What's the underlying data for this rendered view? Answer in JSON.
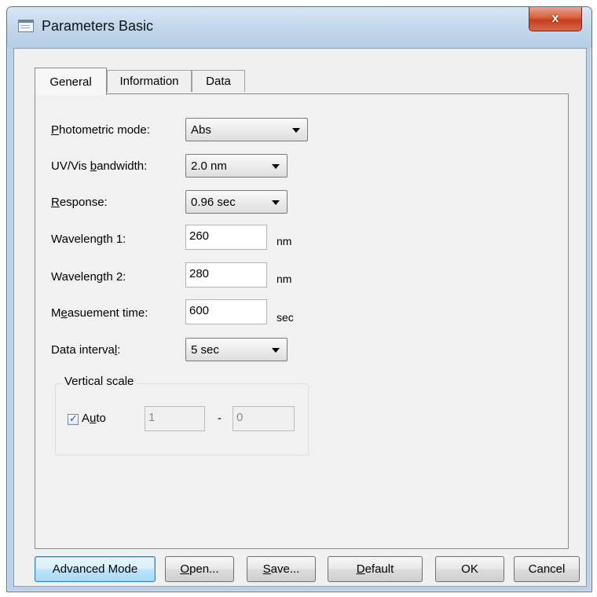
{
  "window": {
    "title": "Parameters  Basic",
    "close_glyph": "x"
  },
  "tabs": [
    {
      "label": "General",
      "active": true
    },
    {
      "label": "Information",
      "active": false
    },
    {
      "label": "Data",
      "active": false
    }
  ],
  "fields": {
    "photometric_mode": {
      "label_pre": "",
      "label_key": "P",
      "label_post": "hotometric mode:",
      "value": "Abs"
    },
    "bandwidth": {
      "label_pre": "UV/Vis ",
      "label_key": "b",
      "label_post": "andwidth:",
      "value": "2.0 nm"
    },
    "response": {
      "label_pre": "",
      "label_key": "R",
      "label_post": "esponse:",
      "value": "0.96 sec"
    },
    "wavelength1": {
      "label": "Wavelength 1:",
      "value": "260",
      "unit": "nm"
    },
    "wavelength2": {
      "label": "Wavelength 2:",
      "value": "280",
      "unit": "nm"
    },
    "measurement_time": {
      "label_pre": "M",
      "label_key": "e",
      "label_post": "asuement time:",
      "value": "600",
      "unit": "sec"
    },
    "data_interval": {
      "label_pre": "Data interva",
      "label_key": "l",
      "label_post": ":",
      "value": "5 sec"
    }
  },
  "vertical_scale": {
    "title": "Vertical scale",
    "auto_checked": true,
    "auto_label_pre": "A",
    "auto_label_key": "u",
    "auto_label_post": "to",
    "max_value": "1",
    "separator": "-",
    "min_value": "0"
  },
  "buttons": {
    "advanced_mode": "Advanced Mode",
    "open_key": "O",
    "open_rest": "pen...",
    "save_key": "S",
    "save_rest": "ave...",
    "default_key": "D",
    "default_rest": "efault",
    "ok": "OK",
    "cancel": "Cancel"
  },
  "colors": {
    "close_button": "#c9462a",
    "default_button_border": "#3c7fb1",
    "checkbox_mark": "#2c4d87"
  }
}
